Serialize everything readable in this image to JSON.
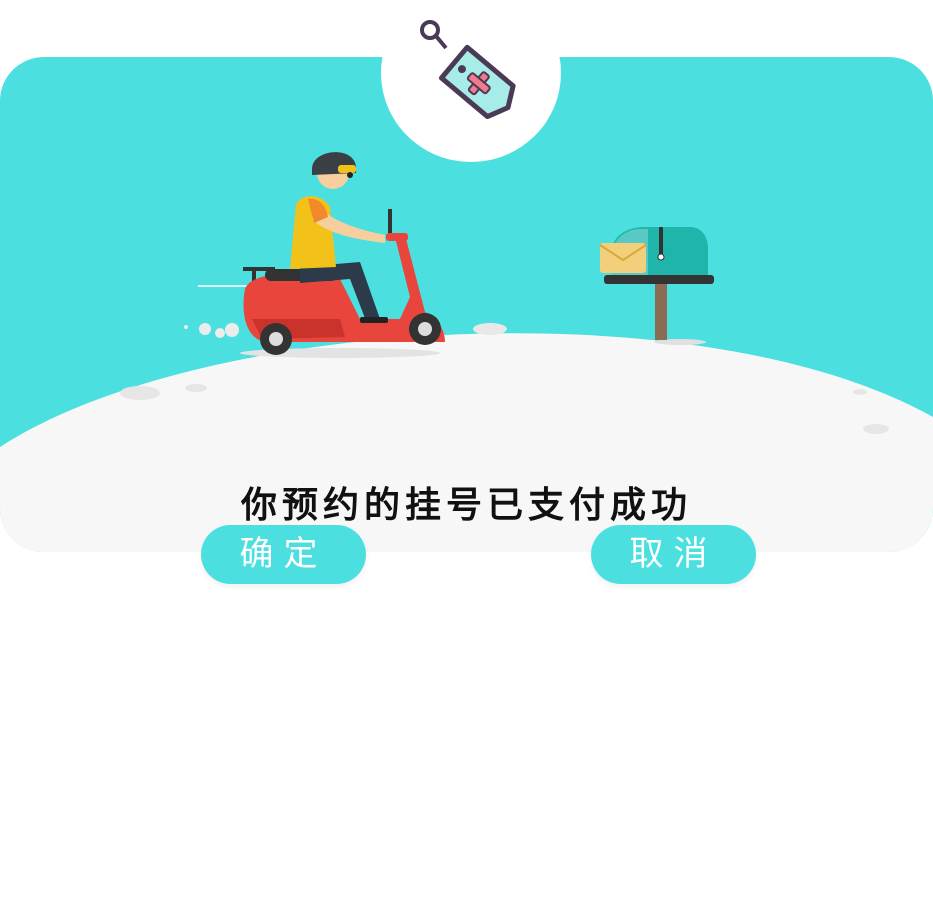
{
  "dialog": {
    "message": "你预约的挂号已支付成功",
    "confirm_label": "确定",
    "cancel_label": "取消"
  },
  "icons": {
    "badge": "medical-tag-icon",
    "rider": "scooter-rider-illustration",
    "mailbox": "mailbox-illustration"
  },
  "colors": {
    "accent": "#4cdfe0",
    "ground": "#f6f6f6",
    "text": "#111111",
    "button_text": "#ffffff"
  }
}
